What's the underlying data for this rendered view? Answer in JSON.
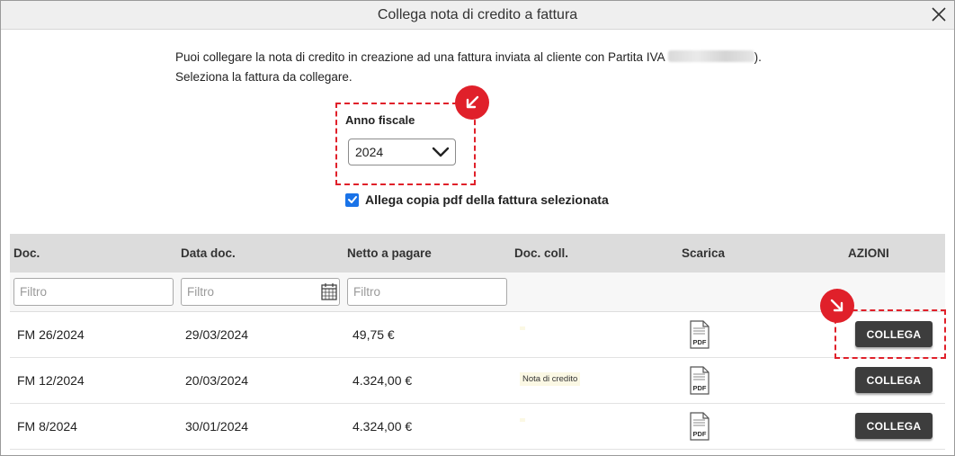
{
  "dialog": {
    "title": "Collega nota di credito a fattura"
  },
  "intro": {
    "line1": "Puoi collegare la nota di credito in creazione ad una fattura inviata al cliente con Partita IVA",
    "line1_end": ").",
    "line2": "Seleziona la fattura da collegare."
  },
  "fiscal_year": {
    "label": "Anno fiscale",
    "selected": "2024"
  },
  "attach_pdf": {
    "label": "Allega copia pdf della fattura selezionata",
    "checked": true
  },
  "table": {
    "headers": [
      "Doc.",
      "Data doc.",
      "Netto a pagare",
      "Doc. coll.",
      "Scarica",
      "AZIONI"
    ],
    "filter_placeholder": "Filtro",
    "rows": [
      {
        "doc": "FM 26/2024",
        "date": "29/03/2024",
        "amount": "49,75 €",
        "linked": "",
        "pdf": "PDF",
        "action": "COLLEGA"
      },
      {
        "doc": "FM 12/2024",
        "date": "20/03/2024",
        "amount": "4.324,00 €",
        "linked": "Nota di credito",
        "pdf": "PDF",
        "action": "COLLEGA"
      },
      {
        "doc": "FM 8/2024",
        "date": "30/01/2024",
        "amount": "4.324,00 €",
        "linked": "",
        "pdf": "PDF",
        "action": "COLLEGA"
      }
    ]
  },
  "colors": {
    "annotation": "#e0202a",
    "checkbox": "#1a73e8",
    "button": "#3d3d3d",
    "header_bg": "#dcdcdc"
  },
  "icons": [
    "close-icon",
    "chevron-down-icon",
    "check-icon",
    "calendar-icon",
    "pdf-icon",
    "arrow-down-left-icon",
    "arrow-down-right-icon"
  ]
}
